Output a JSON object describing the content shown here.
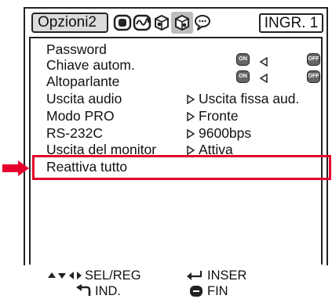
{
  "header": {
    "active_tab": "Opzioni2",
    "input_badge": "INGR. 1",
    "tab_icons": [
      "picture-tab-icon",
      "fine-sync-tab-icon",
      "options1-tab-icon",
      "options2-tab-icon",
      "language-tab-icon"
    ]
  },
  "menu": {
    "items": [
      {
        "label": "Password"
      },
      {
        "label": "Chiave autom."
      },
      {
        "label": "Altoparlante"
      },
      {
        "label": "Uscita audio",
        "value": "Uscita fissa aud."
      },
      {
        "label": "Modo PRO",
        "value": "Fronte"
      },
      {
        "label": "RS-232C",
        "value": "9600bps"
      },
      {
        "label": "Uscita del monitor",
        "value": "Attiva"
      },
      {
        "label": "Reattiva tutto"
      }
    ],
    "toggle_on": "ON",
    "toggle_off": "OFF"
  },
  "colors": {
    "highlight": "#e4002b"
  },
  "footer": {
    "sel_reg": "SEL/REG",
    "inser": "INSER",
    "ind": "IND.",
    "fin": "FIN"
  }
}
